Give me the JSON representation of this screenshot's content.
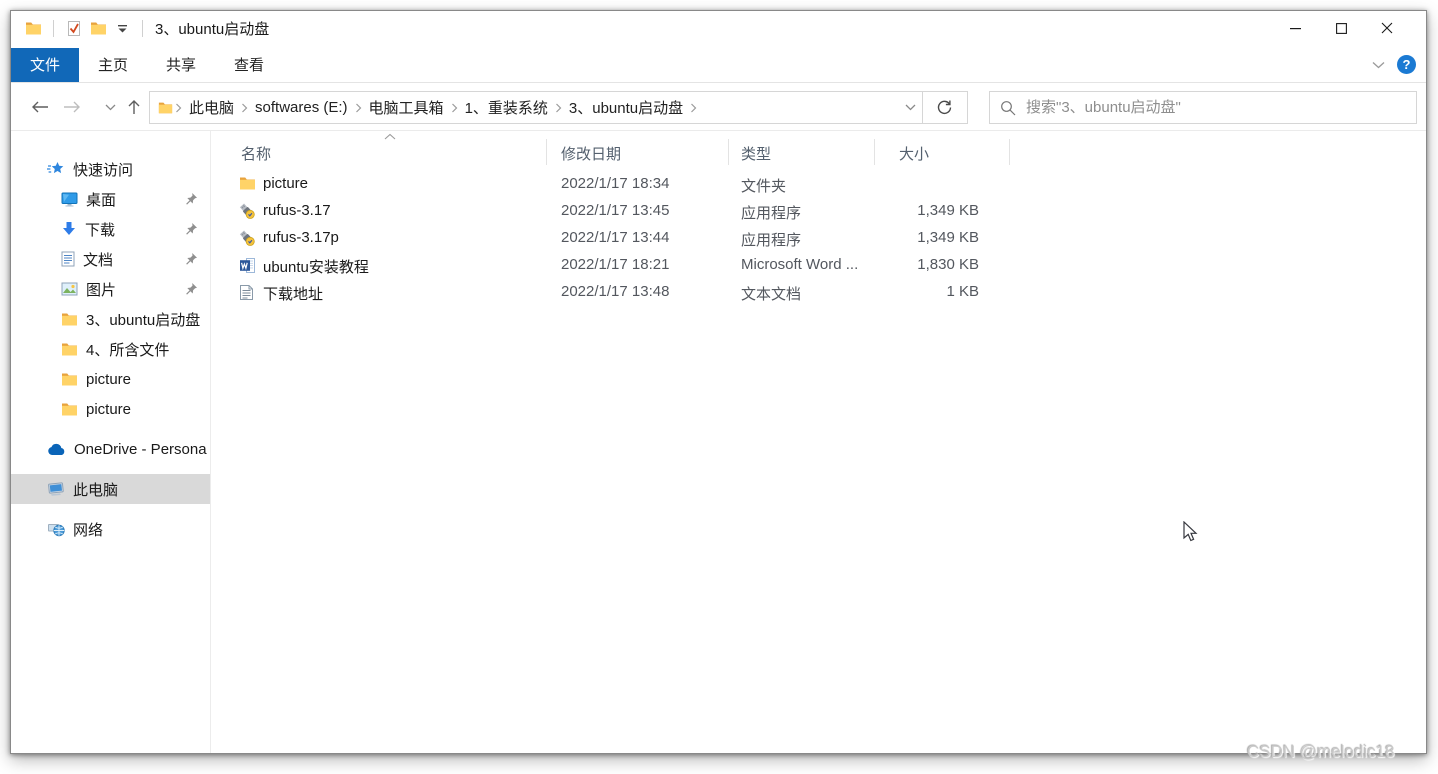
{
  "ui_colors": {
    "active_tab_blue": "#1168b8",
    "help_badge_blue": "#1b7ad3",
    "folder_yellow": "#ffd367",
    "sidebar_selection_gray": "#d9d9d9"
  },
  "titlebar": {
    "title": "3、ubuntu启动盘"
  },
  "ribbon": {
    "tabs": [
      {
        "label": "文件",
        "active": true
      },
      {
        "label": "主页",
        "active": false
      },
      {
        "label": "共享",
        "active": false
      },
      {
        "label": "查看",
        "active": false
      }
    ]
  },
  "address": {
    "breadcrumbs": [
      "此电脑",
      "softwares (E:)",
      "电脑工具箱",
      "1、重装系统",
      "3、ubuntu启动盘"
    ]
  },
  "search": {
    "placeholder": "搜索\"3、ubuntu启动盘\""
  },
  "sidebar": {
    "quick_access_label": "快速访问",
    "items": [
      {
        "label": "桌面",
        "pinned": true
      },
      {
        "label": "下载",
        "pinned": true
      },
      {
        "label": "文档",
        "pinned": true
      },
      {
        "label": "图片",
        "pinned": true
      },
      {
        "label": "3、ubuntu启动盘",
        "pinned": false
      },
      {
        "label": "4、所含文件",
        "pinned": false
      },
      {
        "label": "picture",
        "pinned": false
      },
      {
        "label": "picture",
        "pinned": false
      },
      {
        "label": "OneDrive - Persona",
        "pinned": false
      },
      {
        "label": "此电脑",
        "pinned": false,
        "selected": true
      },
      {
        "label": "网络",
        "pinned": false
      }
    ]
  },
  "file_list": {
    "columns": {
      "name": "名称",
      "date": "修改日期",
      "type": "类型",
      "size": "大小"
    },
    "rows": [
      {
        "name": "picture",
        "date": "2022/1/17 18:34",
        "type": "文件夹",
        "size": ""
      },
      {
        "name": "rufus-3.17",
        "date": "2022/1/17 13:45",
        "type": "应用程序",
        "size": "1,349 KB"
      },
      {
        "name": "rufus-3.17p",
        "date": "2022/1/17 13:44",
        "type": "应用程序",
        "size": "1,349 KB"
      },
      {
        "name": "ubuntu安装教程",
        "date": "2022/1/17 18:21",
        "type": "Microsoft Word ...",
        "size": "1,830 KB"
      },
      {
        "name": "下载地址",
        "date": "2022/1/17 13:48",
        "type": "文本文档",
        "size": "1 KB"
      }
    ]
  },
  "watermark": "CSDN @melodic18"
}
